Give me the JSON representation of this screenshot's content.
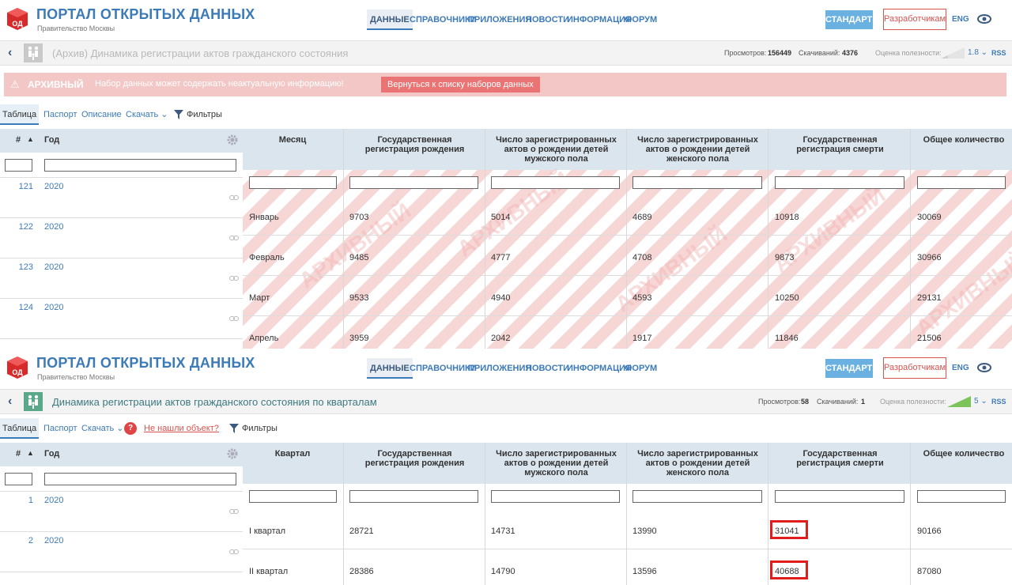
{
  "colors": {
    "accent": "#3d7ab8",
    "warning": "#f4c7c7",
    "highlight": "#e01c1c"
  },
  "portal": {
    "title": "ПОРТАЛ ОТКРЫТЫХ ДАННЫХ",
    "subtitle": "Правительство Москвы",
    "logo_text": "ОД"
  },
  "nav": {
    "items": [
      "ДАННЫЕ",
      "СПРАВОЧНИКИ",
      "ПРИЛОЖЕНИЯ",
      "НОВОСТИ",
      "ИНФОРМАЦИЯ",
      "ФОРУМ"
    ],
    "active": "ДАННЫЕ"
  },
  "header_buttons": {
    "standards": "СТАНДАРТЫ",
    "developers": "Разработчикам",
    "lang": "ENG"
  },
  "panel1": {
    "dataset_title": "(Архив) Динамика регистрации актов гражданского состояния",
    "views_label": "Просмотров:",
    "views": "156449",
    "downloads_label": "Скачиваний:",
    "downloads": "4376",
    "usefulness_label": "Оценка полезности:",
    "rating": "1.8 ⌄",
    "rss": "RSS",
    "warning": {
      "label": "АРХИВНЫЙ",
      "text": "Набор данных может содержать неактуальную информацию!",
      "button": "Вернуться к списку наборов данных"
    },
    "tabs": [
      "Таблица",
      "Паспорт",
      "Описание",
      "Скачать ⌄",
      "Фильтры"
    ],
    "watermark": "АРХИВНЫЙ",
    "columns": [
      "Месяц",
      "Государственная регистрация рождения",
      "Число зарегистрированных актов о рождении детей мужского пола",
      "Число зарегистрированных актов о рождении детей женского пола",
      "Государственная регистрация смерти",
      "Общее количество"
    ],
    "rows": [
      {
        "num": "121",
        "year": "2020",
        "cells": [
          "Январь",
          "9703",
          "5014",
          "4689",
          "10918",
          "30069"
        ]
      },
      {
        "num": "122",
        "year": "2020",
        "cells": [
          "Февраль",
          "9485",
          "4777",
          "4708",
          "9873",
          "30966"
        ]
      },
      {
        "num": "123",
        "year": "2020",
        "cells": [
          "Март",
          "9533",
          "4940",
          "4593",
          "10250",
          "29131"
        ]
      },
      {
        "num": "124",
        "year": "2020",
        "cells": [
          "Апрель",
          "3959",
          "2042",
          "1917",
          "11846",
          "21506"
        ]
      }
    ]
  },
  "panel2": {
    "dataset_title": "Динамика регистрации актов гражданского состояния по кварталам",
    "views_label": "Просмотров:",
    "views": "58",
    "downloads_label": "Скачиваний:",
    "downloads": "1",
    "usefulness_label": "Оценка полезности:",
    "rating": "5 ⌄",
    "rss": "RSS",
    "tabs": [
      "Таблица",
      "Паспорт",
      "Скачать ⌄",
      "Не нашли объект?",
      "Фильтры"
    ],
    "columns": [
      "Квартал",
      "Государственная регистрация рождения",
      "Число зарегистрированных актов о рождении детей мужского пола",
      "Число зарегистрированных актов о рождении детей женского пола",
      "Государственная регистрация смерти",
      "Общее количество"
    ],
    "rows": [
      {
        "num": "1",
        "year": "2020",
        "cells": [
          "I квартал",
          "28721",
          "14731",
          "13990",
          "31041",
          "90166"
        ]
      },
      {
        "num": "2",
        "year": "2020",
        "cells": [
          "II квартал",
          "28386",
          "14790",
          "13596",
          "40688",
          "87080"
        ]
      }
    ]
  },
  "grid_labels": {
    "hash": "#",
    "year_col": "Год"
  }
}
